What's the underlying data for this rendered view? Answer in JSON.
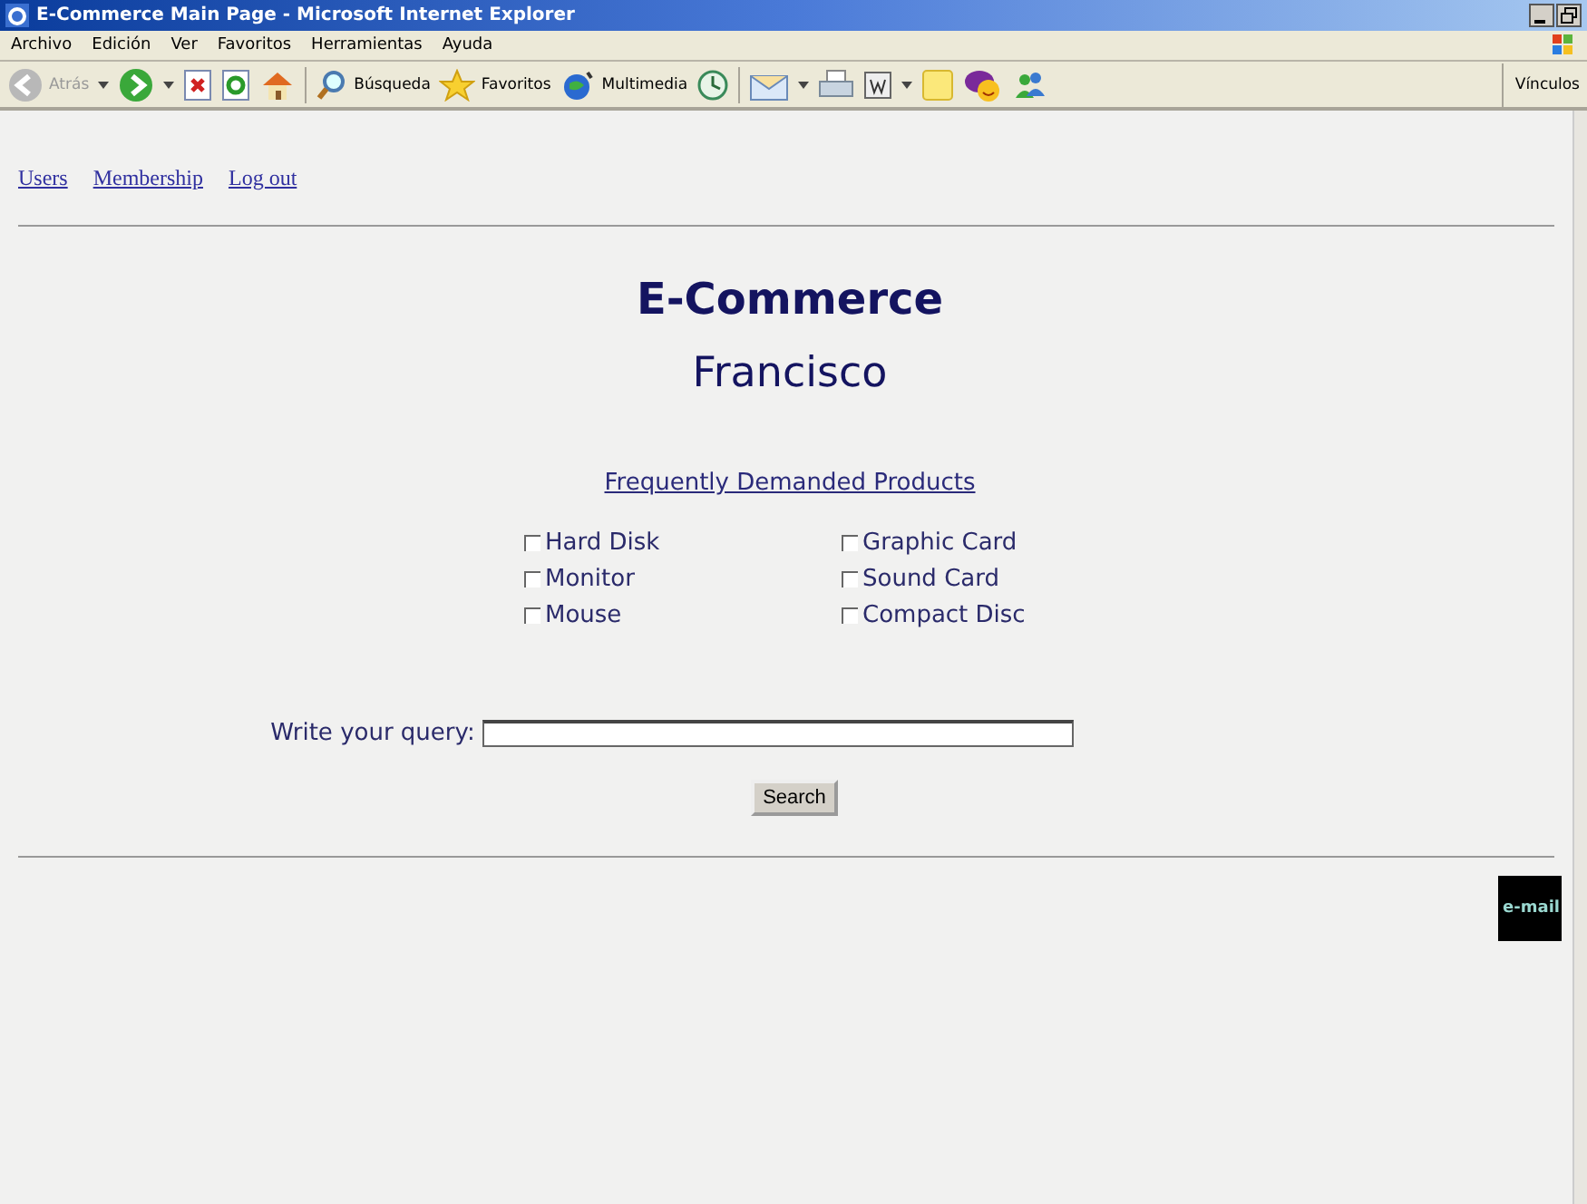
{
  "window": {
    "title": "E-Commerce Main Page - Microsoft Internet Explorer"
  },
  "menu": [
    "Archivo",
    "Edición",
    "Ver",
    "Favoritos",
    "Herramientas",
    "Ayuda"
  ],
  "toolbar": [
    {
      "kind": "back",
      "label": "Atrás",
      "disabled": true
    },
    {
      "kind": "dropdown"
    },
    {
      "kind": "forward"
    },
    {
      "kind": "dropdown"
    },
    {
      "kind": "stop"
    },
    {
      "kind": "refresh"
    },
    {
      "kind": "home"
    },
    {
      "kind": "separator"
    },
    {
      "kind": "search",
      "label": "Búsqueda"
    },
    {
      "kind": "favorites",
      "label": "Favoritos"
    },
    {
      "kind": "media",
      "label": "Multimedia"
    },
    {
      "kind": "history"
    },
    {
      "kind": "separator"
    },
    {
      "kind": "mail"
    },
    {
      "kind": "dropdown"
    },
    {
      "kind": "print"
    },
    {
      "kind": "word"
    },
    {
      "kind": "dropdown"
    },
    {
      "kind": "note"
    },
    {
      "kind": "chat"
    },
    {
      "kind": "people"
    }
  ],
  "links_label": "Vínculos",
  "nav_links": [
    "Users",
    "Membership",
    "Log out"
  ],
  "heading": "E-Commerce",
  "user": "Francisco",
  "products_title": "Frequently Demanded Products",
  "products": [
    {
      "label": "Hard Disk",
      "checked": false
    },
    {
      "label": "Graphic Card",
      "checked": false
    },
    {
      "label": "Monitor",
      "checked": false
    },
    {
      "label": "Sound Card",
      "checked": false
    },
    {
      "label": "Mouse",
      "checked": false
    },
    {
      "label": "Compact Disc",
      "checked": false
    }
  ],
  "query": {
    "label": "Write your query:"
  },
  "search_button": "Search",
  "email_badge": "e-mail"
}
